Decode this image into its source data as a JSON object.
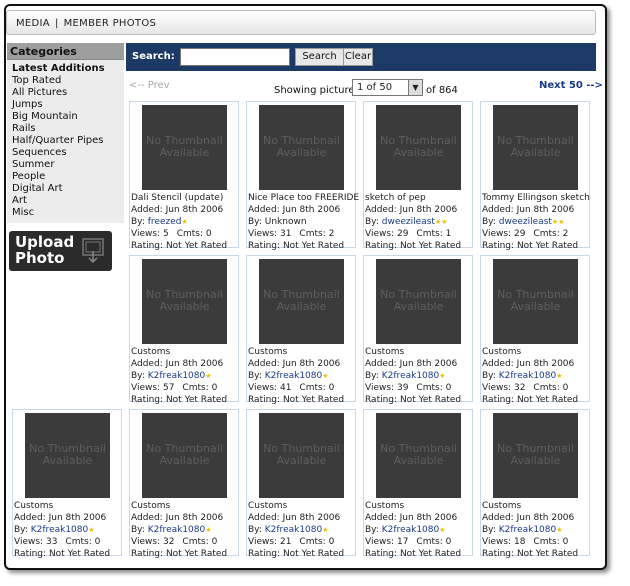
{
  "header": {
    "section": "MEDIA",
    "page": "MEMBER PHOTOS"
  },
  "sidebar": {
    "heading": "Categories",
    "items": [
      "Latest Additions",
      "Top Rated",
      "All Pictures",
      "Jumps",
      "Big Mountain",
      "Rails",
      "Half/Quarter Pipes",
      "Sequences",
      "Summer",
      "People",
      "Digital Art",
      "Art",
      "Misc"
    ],
    "active_index": 0
  },
  "upload": {
    "line1": "Upload",
    "line2": "Photo"
  },
  "search": {
    "label": "Search:",
    "value": "",
    "search_button": "Search",
    "clear_button": "Clear"
  },
  "pager": {
    "prev": "<-- Prev",
    "showing": "Showing pictures",
    "page_select": "1 of 50",
    "total": "of 864",
    "next": "Next 50 -->"
  },
  "thumb_text": "No Thumbnail Available",
  "labels": {
    "added": "Added:",
    "by": "By:",
    "views": "Views:",
    "cmts": "Cmts:",
    "rating": "Rating:"
  },
  "photos": [
    {
      "title": "Dali Stencil (update)",
      "added": "Jun 8th 2006",
      "by": "freezed",
      "by_link": true,
      "stars": 1,
      "views": "5",
      "cmts": "0",
      "rating": "Not Yet Rated"
    },
    {
      "title": "Nice Place too FREERIDE",
      "added": "Jun 8th 2006",
      "by": "Unknown",
      "by_link": false,
      "stars": 0,
      "views": "31",
      "cmts": "2",
      "rating": "Not Yet Rated"
    },
    {
      "title": "sketch of pep",
      "added": "Jun 8th 2006",
      "by": "dweezileast",
      "by_link": true,
      "stars": 2,
      "views": "29",
      "cmts": "1",
      "rating": "Not Yet Rated"
    },
    {
      "title": "Tommy Ellingson sketch",
      "added": "Jun 8th 2006",
      "by": "dweezileast",
      "by_link": true,
      "stars": 2,
      "views": "29",
      "cmts": "2",
      "rating": "Not Yet Rated"
    },
    {
      "title": "Customs",
      "added": "Jun 8th 2006",
      "by": "K2freak1080",
      "by_link": true,
      "stars": 1,
      "views": "57",
      "cmts": "0",
      "rating": "Not Yet Rated"
    },
    {
      "title": "Customs",
      "added": "Jun 8th 2006",
      "by": "K2freak1080",
      "by_link": true,
      "stars": 1,
      "views": "41",
      "cmts": "0",
      "rating": "Not Yet Rated"
    },
    {
      "title": "Customs",
      "added": "Jun 8th 2006",
      "by": "K2freak1080",
      "by_link": true,
      "stars": 1,
      "views": "39",
      "cmts": "0",
      "rating": "Not Yet Rated"
    },
    {
      "title": "Customs",
      "added": "Jun 8th 2006",
      "by": "K2freak1080",
      "by_link": true,
      "stars": 1,
      "views": "32",
      "cmts": "0",
      "rating": "Not Yet Rated"
    },
    {
      "title": "Customs",
      "added": "Jun 8th 2006",
      "by": "K2freak1080",
      "by_link": true,
      "stars": 1,
      "views": "33",
      "cmts": "0",
      "rating": "Not Yet Rated"
    },
    {
      "title": "Customs",
      "added": "Jun 8th 2006",
      "by": "K2freak1080",
      "by_link": true,
      "stars": 1,
      "views": "32",
      "cmts": "0",
      "rating": "Not Yet Rated"
    },
    {
      "title": "Customs",
      "added": "Jun 8th 2006",
      "by": "K2freak1080",
      "by_link": true,
      "stars": 1,
      "views": "21",
      "cmts": "0",
      "rating": "Not Yet Rated"
    },
    {
      "title": "Customs",
      "added": "Jun 8th 2006",
      "by": "K2freak1080",
      "by_link": true,
      "stars": 1,
      "views": "17",
      "cmts": "0",
      "rating": "Not Yet Rated"
    },
    {
      "title": "Customs",
      "added": "Jun 8th 2006",
      "by": "K2freak1080",
      "by_link": true,
      "stars": 1,
      "views": "18",
      "cmts": "0",
      "rating": "Not Yet Rated"
    }
  ]
}
